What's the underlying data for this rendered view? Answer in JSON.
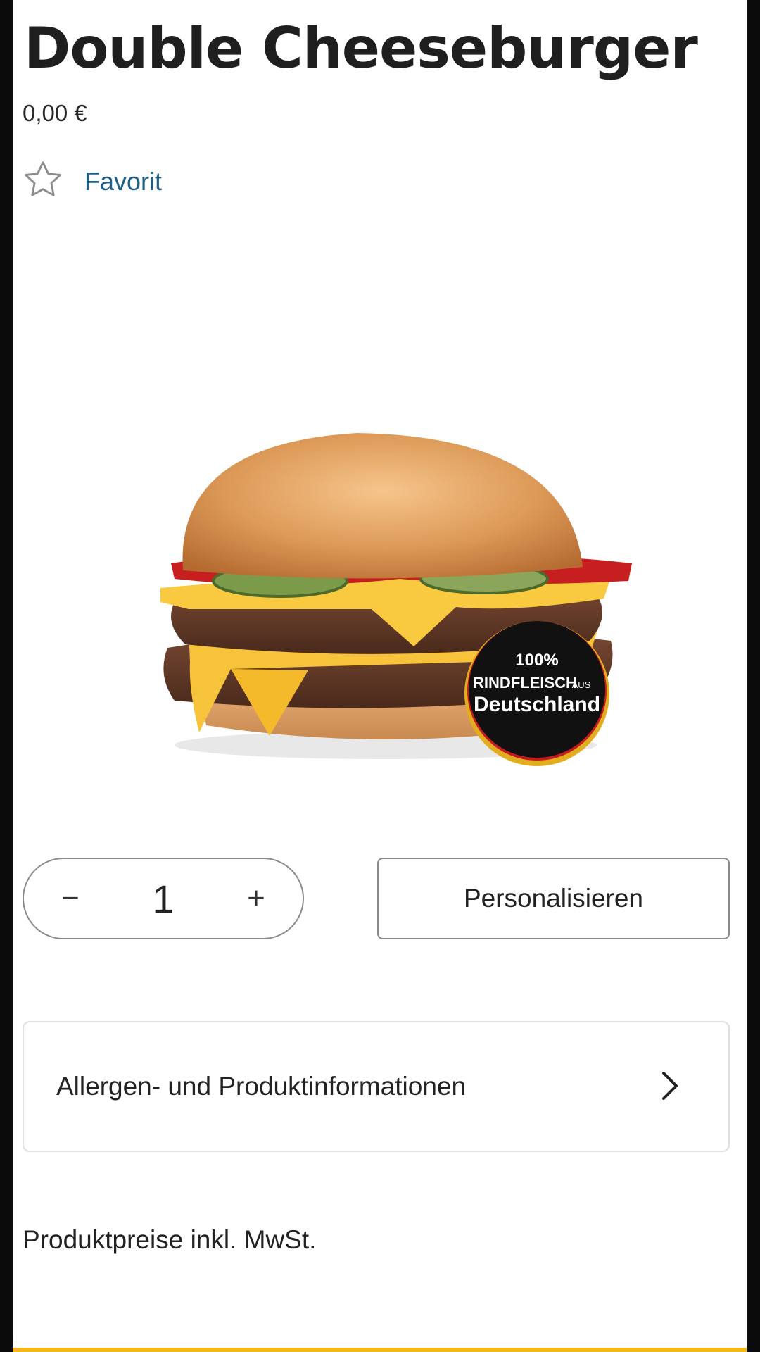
{
  "product": {
    "name": "Double Cheeseburger",
    "price": "0,00 €",
    "favorite_label": "Favorit",
    "badge": {
      "line1": "100%",
      "line2": "RINDFLEISCH",
      "line2_small": "AUS",
      "line3": "Deutschland"
    }
  },
  "quantity": {
    "minus_label": "−",
    "value": "1",
    "plus_label": "+"
  },
  "personalize_label": "Personalisieren",
  "info": {
    "label": "Allergen- und Produktinformationen"
  },
  "footer_note": "Produktpreise inkl. MwSt.",
  "colors": {
    "link": "#1d5f86",
    "accent": "#f3b71b"
  },
  "icons": {
    "favorite": "star-outline-icon",
    "info_arrow": "chevron-right-icon"
  }
}
